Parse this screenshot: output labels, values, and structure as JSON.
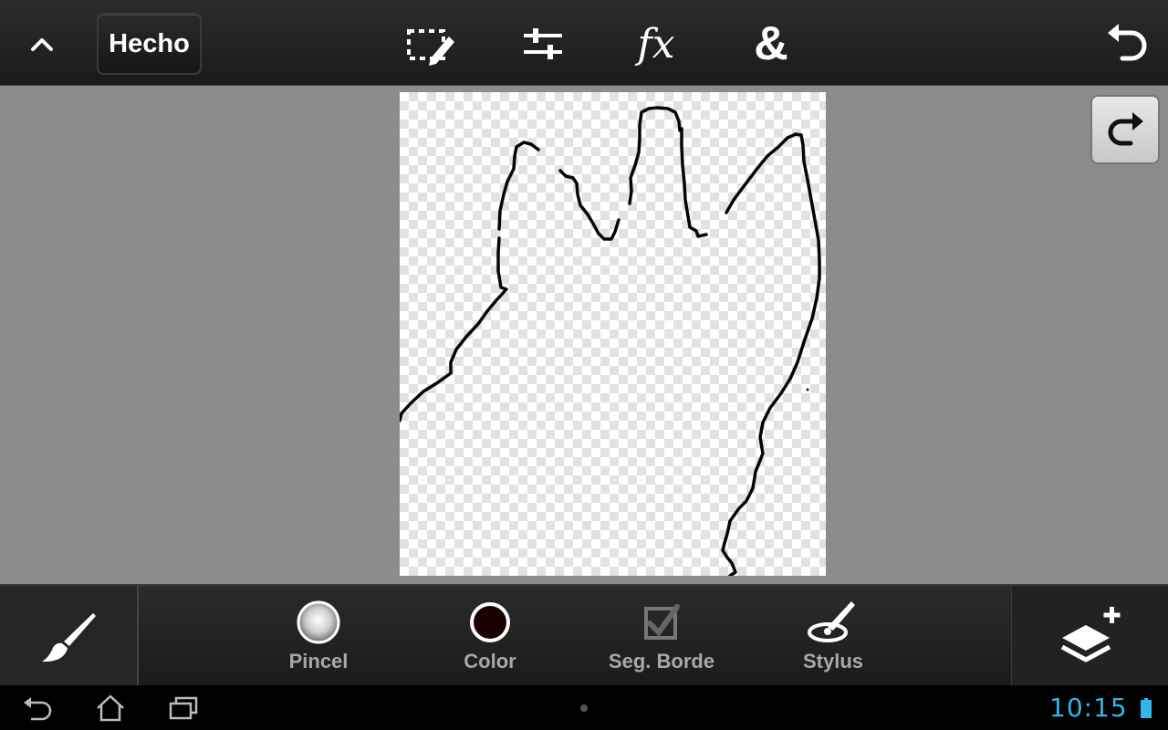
{
  "toolbar": {
    "done_label": "Hecho",
    "fx_label": "fx",
    "amp_label": "&"
  },
  "brush_options": {
    "pincel": "Pincel",
    "color": "Color",
    "edge": "Seg. Borde",
    "stylus": "Stylus"
  },
  "brush_color": "#1a0202",
  "status": {
    "time": "10:15"
  },
  "icons": [
    "chevron-up-icon",
    "selection-pencil-icon",
    "adjust-sliders-icon",
    "undo-icon",
    "redo-icon",
    "brush-icon",
    "layers-add-icon",
    "checkbox-icon",
    "stylus-icon",
    "back-icon",
    "home-icon",
    "recent-apps-icon",
    "battery-icon"
  ]
}
